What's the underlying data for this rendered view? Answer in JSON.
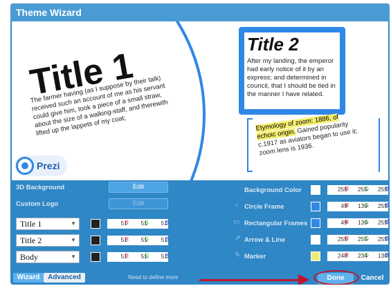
{
  "window": {
    "title": "Theme Wizard"
  },
  "preview": {
    "title1": "Title 1",
    "title1_body": "The farmer having (as I suppose by their talk) received such an account of me as his servant could give him, took a piece of a small straw, about the size of a walking-staff, and therewith lifted up the lappets of my coat;",
    "title2": "Title 2",
    "title2_body": "After my landing, the emperor had early notice of it by an express; and determined in council, that I should be tied in the manner I have related.",
    "etym_highlight": "Etymology of zoom: 1886, of echoic origin.",
    "etym_rest": "Gained popularity c.1917 as aviators began to use it; zoom lens is 1936.",
    "logo_text": "Prezi"
  },
  "left": {
    "bg3d_label": "3D Background",
    "bg3d_button": "Edit",
    "logo_label": "Custom Logo",
    "logo_button": "Edit",
    "fonts": [
      {
        "value": "Title 1",
        "color": "#222222",
        "r": "51",
        "g": "51",
        "b": "51"
      },
      {
        "value": "Title 2",
        "color": "#222222",
        "r": "51",
        "g": "51",
        "b": "51"
      },
      {
        "value": "Body",
        "color": "#222222",
        "r": "51",
        "g": "51",
        "b": "51"
      }
    ]
  },
  "right": {
    "items": [
      {
        "label": "Background Color",
        "icon": "",
        "color": "#ffffff",
        "r": "255",
        "g": "255",
        "b": "255"
      },
      {
        "label": "Circle Frame",
        "icon": "circle-frame-icon",
        "color": "#3189e6",
        "r": "49",
        "g": "139",
        "b": "255"
      },
      {
        "label": "Rectangular Frames",
        "icon": "rect-frame-icon",
        "color": "#3189e6",
        "r": "49",
        "g": "139",
        "b": "255"
      },
      {
        "label": "Arrow & Line",
        "icon": "arrow-icon",
        "color": "#ffffff",
        "r": "255",
        "g": "255",
        "b": "255"
      },
      {
        "label": "Marker",
        "icon": "marker-icon",
        "color": "#f0ea7c",
        "r": "240",
        "g": "234",
        "b": "130"
      }
    ]
  },
  "rgb_tags": {
    "r": "R",
    "g": "G",
    "b": "B"
  },
  "bottom": {
    "tab_wizard": "Wizard",
    "tab_advanced": "Advanced",
    "note": "Need to define more",
    "done": "Done",
    "cancel": "Cancel"
  }
}
